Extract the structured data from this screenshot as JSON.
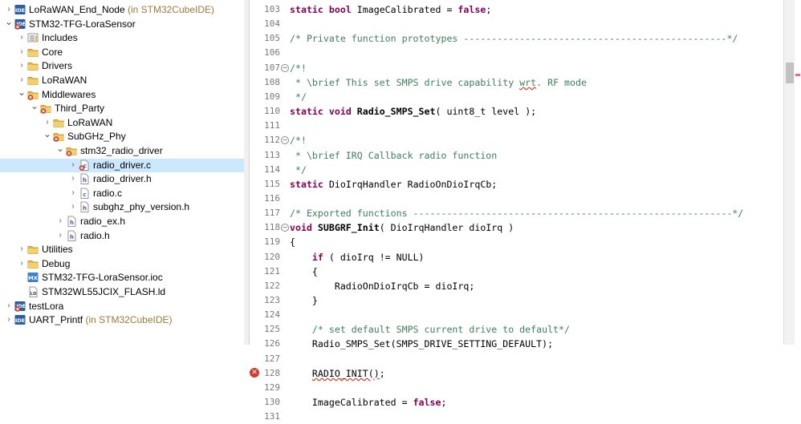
{
  "tree": [
    {
      "depth": 0,
      "arrow": "right",
      "icon": "ide",
      "label": "LoRaWAN_End_Node",
      "suffix": " (in STM32CubeIDE)"
    },
    {
      "depth": 0,
      "arrow": "down",
      "icon": "ide-error",
      "label": "STM32-TFG-LoraSensor",
      "suffix": ""
    },
    {
      "depth": 1,
      "arrow": "right",
      "icon": "includes",
      "label": "Includes",
      "suffix": ""
    },
    {
      "depth": 1,
      "arrow": "right",
      "icon": "folder",
      "label": "Core",
      "suffix": ""
    },
    {
      "depth": 1,
      "arrow": "right",
      "icon": "folder",
      "label": "Drivers",
      "suffix": ""
    },
    {
      "depth": 1,
      "arrow": "right",
      "icon": "folder",
      "label": "LoRaWAN",
      "suffix": ""
    },
    {
      "depth": 1,
      "arrow": "down",
      "icon": "folder-error",
      "label": "Middlewares",
      "suffix": ""
    },
    {
      "depth": 2,
      "arrow": "down",
      "icon": "folder-error",
      "label": "Third_Party",
      "suffix": ""
    },
    {
      "depth": 3,
      "arrow": "right",
      "icon": "folder",
      "label": "LoRaWAN",
      "suffix": ""
    },
    {
      "depth": 3,
      "arrow": "down",
      "icon": "folder-error",
      "label": "SubGHz_Phy",
      "suffix": ""
    },
    {
      "depth": 4,
      "arrow": "down",
      "icon": "folder-error",
      "label": "stm32_radio_driver",
      "suffix": ""
    },
    {
      "depth": 5,
      "arrow": "right",
      "icon": "c-file-error",
      "label": "radio_driver.c",
      "suffix": "",
      "selected": true
    },
    {
      "depth": 5,
      "arrow": "right",
      "icon": "h-file",
      "label": "radio_driver.h",
      "suffix": ""
    },
    {
      "depth": 5,
      "arrow": "right",
      "icon": "c-file",
      "label": "radio.c",
      "suffix": ""
    },
    {
      "depth": 5,
      "arrow": "right",
      "icon": "h-file",
      "label": "subghz_phy_version.h",
      "suffix": ""
    },
    {
      "depth": 4,
      "arrow": "right",
      "icon": "h-file",
      "label": "radio_ex.h",
      "suffix": ""
    },
    {
      "depth": 4,
      "arrow": "right",
      "icon": "h-file",
      "label": "radio.h",
      "suffix": ""
    },
    {
      "depth": 1,
      "arrow": "right",
      "icon": "folder",
      "label": "Utilities",
      "suffix": ""
    },
    {
      "depth": 1,
      "arrow": "right",
      "icon": "folder",
      "label": "Debug",
      "suffix": ""
    },
    {
      "depth": 1,
      "arrow": "none",
      "icon": "mx",
      "label": "STM32-TFG-LoraSensor.ioc",
      "suffix": ""
    },
    {
      "depth": 1,
      "arrow": "none",
      "icon": "ld",
      "label": "STM32WL55JCIX_FLASH.ld",
      "suffix": ""
    },
    {
      "depth": 0,
      "arrow": "right",
      "icon": "ide-error",
      "label": "testLora",
      "suffix": ""
    },
    {
      "depth": 0,
      "arrow": "right",
      "icon": "ide",
      "label": "UART_Printf",
      "suffix": " (in STM32CubeIDE)"
    }
  ],
  "code": [
    {
      "n": "103",
      "fold": "",
      "err": false,
      "tokens": [
        [
          "kw",
          "static "
        ],
        [
          "kw",
          "bool "
        ],
        [
          "",
          "ImageCalibrated = "
        ],
        [
          "kw",
          "false"
        ],
        [
          "",
          ";"
        ]
      ]
    },
    {
      "n": "104",
      "fold": "",
      "err": false,
      "tokens": []
    },
    {
      "n": "105",
      "fold": "",
      "err": false,
      "tokens": [
        [
          "cm",
          "/* Private function prototypes -----------------------------------------------*/"
        ]
      ]
    },
    {
      "n": "106",
      "fold": "",
      "err": false,
      "tokens": []
    },
    {
      "n": "107",
      "fold": "−",
      "err": false,
      "tokens": [
        [
          "cm",
          "/*!"
        ]
      ]
    },
    {
      "n": "108",
      "fold": "",
      "err": false,
      "tokens": [
        [
          "cm",
          " * \\brief This set SMPS drive capability "
        ],
        [
          "cm sq",
          "wrt"
        ],
        [
          "cm",
          ". RF mode"
        ]
      ]
    },
    {
      "n": "109",
      "fold": "",
      "err": false,
      "tokens": [
        [
          "cm",
          " */"
        ]
      ]
    },
    {
      "n": "110",
      "fold": "",
      "err": false,
      "tokens": [
        [
          "kw",
          "static "
        ],
        [
          "kw",
          "void "
        ],
        [
          "fn",
          "Radio_SMPS_Set"
        ],
        [
          "",
          "( uint8_t level );"
        ]
      ]
    },
    {
      "n": "111",
      "fold": "",
      "err": false,
      "tokens": []
    },
    {
      "n": "112",
      "fold": "−",
      "err": false,
      "tokens": [
        [
          "cm",
          "/*!"
        ]
      ]
    },
    {
      "n": "113",
      "fold": "",
      "err": false,
      "tokens": [
        [
          "cm",
          " * \\brief IRQ Callback radio function"
        ]
      ]
    },
    {
      "n": "114",
      "fold": "",
      "err": false,
      "tokens": [
        [
          "cm",
          " */"
        ]
      ]
    },
    {
      "n": "115",
      "fold": "",
      "err": false,
      "tokens": [
        [
          "kw",
          "static "
        ],
        [
          "",
          "DioIrqHandler RadioOnDioIrqCb;"
        ]
      ]
    },
    {
      "n": "116",
      "fold": "",
      "err": false,
      "tokens": []
    },
    {
      "n": "117",
      "fold": "",
      "err": false,
      "tokens": [
        [
          "cm",
          "/* Exported functions ---------------------------------------------------------*/"
        ]
      ]
    },
    {
      "n": "118",
      "fold": "−",
      "err": false,
      "tokens": [
        [
          "kw",
          "void "
        ],
        [
          "fn",
          "SUBGRF_Init"
        ],
        [
          "",
          "( DioIrqHandler dioIrq )"
        ]
      ]
    },
    {
      "n": "119",
      "fold": "",
      "err": false,
      "tokens": [
        [
          "",
          "{"
        ]
      ]
    },
    {
      "n": "120",
      "fold": "",
      "err": false,
      "tokens": [
        [
          "",
          "    "
        ],
        [
          "kw",
          "if"
        ],
        [
          "",
          " ( dioIrq != NULL)"
        ]
      ]
    },
    {
      "n": "121",
      "fold": "",
      "err": false,
      "tokens": [
        [
          "",
          "    {"
        ]
      ]
    },
    {
      "n": "122",
      "fold": "",
      "err": false,
      "tokens": [
        [
          "",
          "        RadioOnDioIrqCb = dioIrq;"
        ]
      ]
    },
    {
      "n": "123",
      "fold": "",
      "err": false,
      "tokens": [
        [
          "",
          "    }"
        ]
      ]
    },
    {
      "n": "124",
      "fold": "",
      "err": false,
      "tokens": []
    },
    {
      "n": "125",
      "fold": "",
      "err": false,
      "tokens": [
        [
          "cm",
          "    /* set default SMPS current drive to default*/"
        ]
      ]
    },
    {
      "n": "126",
      "fold": "",
      "err": false,
      "tokens": [
        [
          "",
          "    Radio_SMPS_Set(SMPS_DRIVE_SETTING_DEFAULT);"
        ]
      ]
    },
    {
      "n": "127",
      "fold": "",
      "err": false,
      "tokens": []
    },
    {
      "n": "128",
      "fold": "",
      "err": true,
      "tokens": [
        [
          "",
          "    "
        ],
        [
          "sq",
          "RADIO_INIT()"
        ],
        [
          "",
          ";"
        ]
      ]
    },
    {
      "n": "129",
      "fold": "",
      "err": false,
      "tokens": []
    },
    {
      "n": "130",
      "fold": "",
      "err": false,
      "tokens": [
        [
          "",
          "    ImageCalibrated = "
        ],
        [
          "kw",
          "false"
        ],
        [
          "",
          ";"
        ]
      ]
    },
    {
      "n": "131",
      "fold": "",
      "err": false,
      "tokens": []
    }
  ],
  "colors": {
    "keyword": "#7f0055",
    "comment": "#3f7f5f",
    "selection": "#cce8ff",
    "error": "#d23b2a"
  }
}
